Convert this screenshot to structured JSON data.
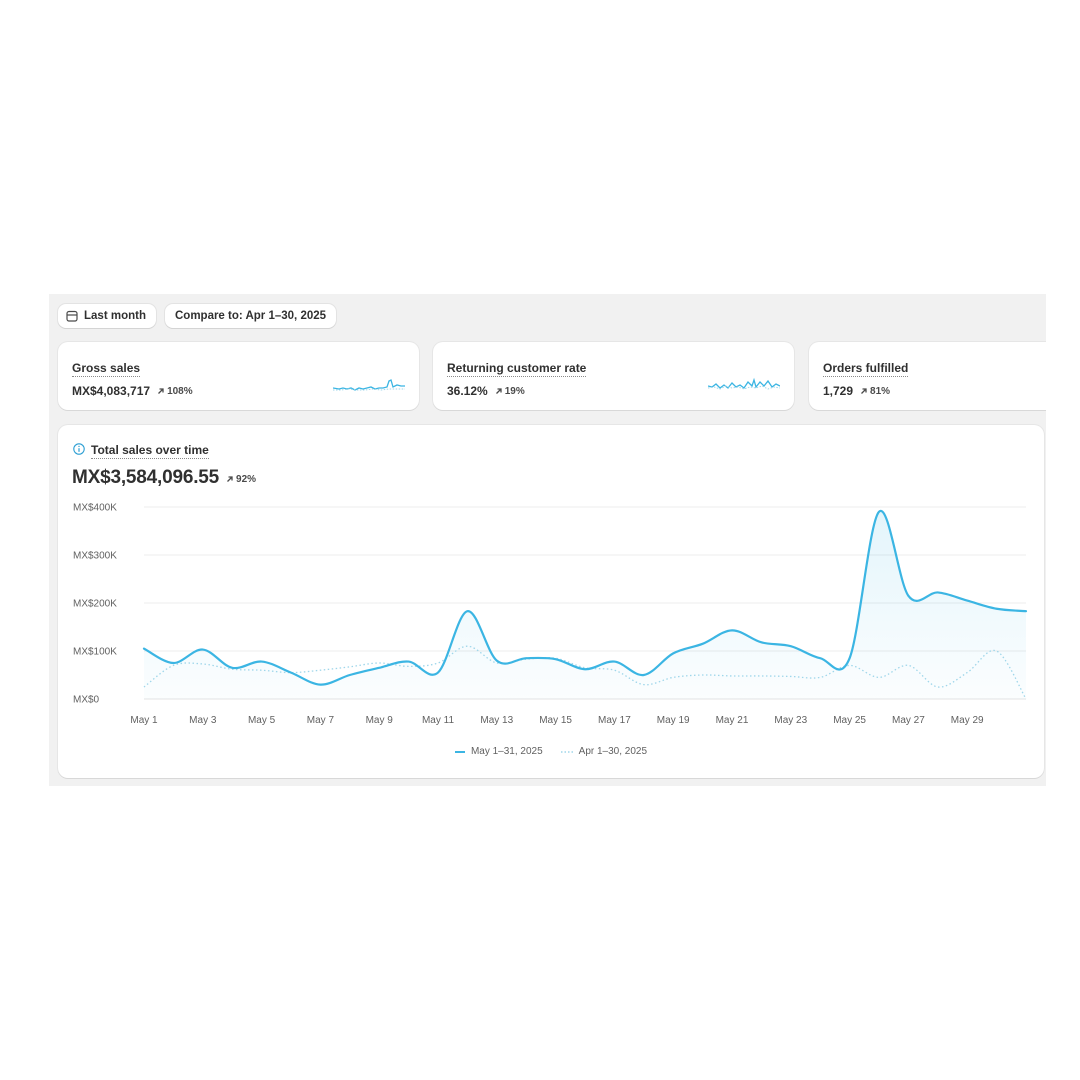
{
  "filters": {
    "date_range_label": "Last month",
    "compare_label": "Compare to: Apr 1–30, 2025"
  },
  "metrics": [
    {
      "title": "Gross sales",
      "value": "MX$4,083,717",
      "change": "108%"
    },
    {
      "title": "Returning customer rate",
      "value": "36.12%",
      "change": "19%"
    },
    {
      "title": "Orders fulfilled",
      "value": "1,729",
      "change": "81%"
    }
  ],
  "main_chart": {
    "title": "Total sales over time",
    "total": "MX$3,584,096.55",
    "change": "92%"
  },
  "colors": {
    "accent": "#3bb5e3",
    "compare_line": "#9fd6ea",
    "card_bg": "#ffffff",
    "panel_bg": "#f1f1f1"
  },
  "chart_data": {
    "type": "line",
    "title": "Total sales over time",
    "x": [
      "May 1",
      "May 2",
      "May 3",
      "May 4",
      "May 5",
      "May 6",
      "May 7",
      "May 8",
      "May 9",
      "May 10",
      "May 11",
      "May 12",
      "May 13",
      "May 14",
      "May 15",
      "May 16",
      "May 17",
      "May 18",
      "May 19",
      "May 20",
      "May 21",
      "May 22",
      "May 23",
      "May 24",
      "May 25",
      "May 26",
      "May 27",
      "May 28",
      "May 29",
      "May 30",
      "May 31"
    ],
    "x_tick_labels": [
      "May 1",
      "May 3",
      "May 5",
      "May 7",
      "May 9",
      "May 11",
      "May 13",
      "May 15",
      "May 17",
      "May 19",
      "May 21",
      "May 23",
      "May 25",
      "May 27",
      "May 29"
    ],
    "y_tick_labels": [
      "MX$400K",
      "MX$300K",
      "MX$200K",
      "MX$100K",
      "MX$0"
    ],
    "ylim": [
      0,
      400000
    ],
    "grid": true,
    "legend_position": "bottom",
    "series": [
      {
        "name": "May 1–31, 2025",
        "style": "solid",
        "color": "#3bb5e3",
        "values": [
          105000,
          75000,
          103000,
          65000,
          78000,
          55000,
          30000,
          50000,
          65000,
          78000,
          55000,
          183000,
          80000,
          85000,
          83000,
          62000,
          78000,
          50000,
          95000,
          115000,
          143000,
          118000,
          110000,
          85000,
          85000,
          390000,
          215000,
          222000,
          205000,
          188000,
          183000
        ]
      },
      {
        "name": "Apr 1–30, 2025",
        "style": "dotted",
        "color": "#9fd6ea",
        "values": [
          25000,
          70000,
          73000,
          62000,
          60000,
          55000,
          60000,
          67000,
          75000,
          68000,
          75000,
          110000,
          75000,
          83000,
          85000,
          65000,
          60000,
          30000,
          45000,
          50000,
          48000,
          48000,
          47000,
          45000,
          70000,
          45000,
          70000,
          25000,
          55000,
          100000,
          0
        ]
      }
    ]
  }
}
